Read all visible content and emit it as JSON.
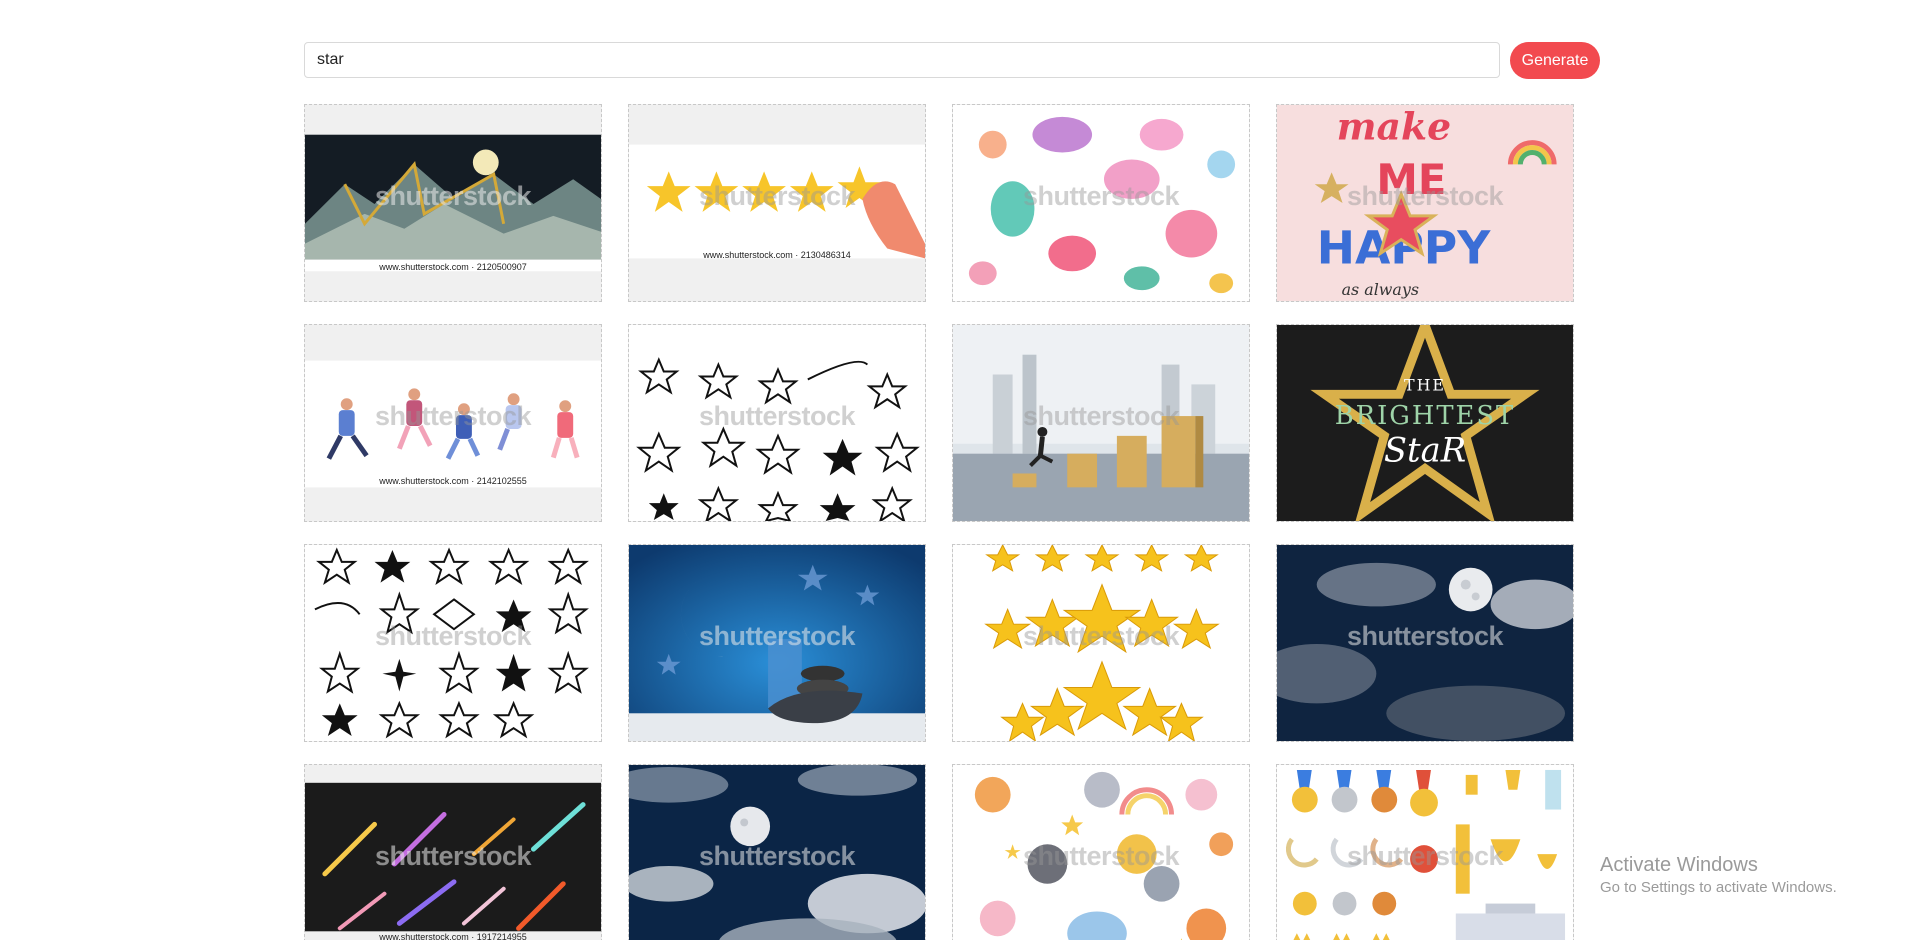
{
  "search": {
    "value": "star"
  },
  "toolbar": {
    "generate_label": "Generate"
  },
  "results": {
    "watermark": "shutterstock",
    "tiles": [
      {
        "subject": "mountains-moon",
        "id_text": "www.shutterstock.com · 2120500907"
      },
      {
        "subject": "five-star-rating-hand",
        "id_text": "www.shutterstock.com · 2130486314"
      },
      {
        "subject": "mermaid-pattern",
        "id_text": ""
      },
      {
        "subject": "make-me-happy",
        "id_text": ""
      },
      {
        "subject": "jumping-people",
        "id_text": "www.shutterstock.com · 2142102555"
      },
      {
        "subject": "doodle-stars",
        "id_text": ""
      },
      {
        "subject": "businessman-steps",
        "id_text": ""
      },
      {
        "subject": "brightest-star",
        "id_text": ""
      },
      {
        "subject": "hand-drawn-stars",
        "id_text": ""
      },
      {
        "subject": "moon-night-product",
        "id_text": ""
      },
      {
        "subject": "gold-stars",
        "id_text": ""
      },
      {
        "subject": "night-sky-moon",
        "id_text": ""
      },
      {
        "subject": "comets",
        "id_text": "www.shutterstock.com · 1917214955"
      },
      {
        "subject": "moon-clouds",
        "id_text": ""
      },
      {
        "subject": "cute-animals",
        "id_text": ""
      },
      {
        "subject": "medals-trophies",
        "id_text": ""
      }
    ]
  },
  "brightest_text": {
    "line1": "THE",
    "line2": "BRIGHTEST",
    "line3": "StaR"
  },
  "happy_text": {
    "line1": "make",
    "line2": "ME",
    "line3": "HAPPY",
    "line4": "as always"
  },
  "os_notice": {
    "title": "Activate Windows",
    "subtitle": "Go to Settings to activate Windows."
  },
  "colors": {
    "accent": "#f24a4f"
  }
}
